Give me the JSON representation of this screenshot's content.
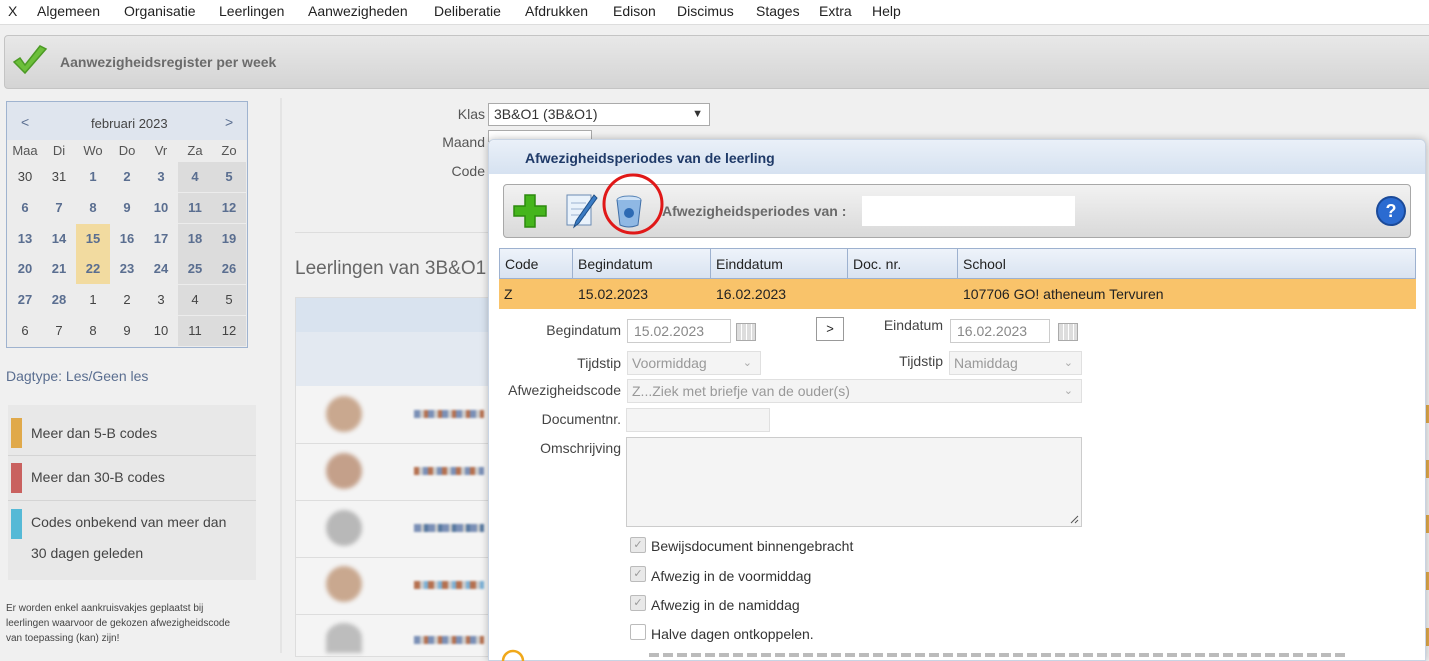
{
  "menu": [
    "X",
    "Algemeen",
    "Organisatie",
    "Leerlingen",
    "Aanwezigheden",
    "Deliberatie",
    "Afdrukken",
    "Edison",
    "Discimus",
    "Stages",
    "Extra",
    "Help"
  ],
  "page_title": "Aanwezigheidsregister per week",
  "calendar": {
    "prev": "<",
    "next": ">",
    "month": "februari 2023",
    "weekdays": [
      "Maa",
      "Di",
      "Wo",
      "Do",
      "Vr",
      "Za",
      "Zo"
    ],
    "rows": [
      [
        "30",
        "31",
        "1",
        "2",
        "3",
        "4",
        "5"
      ],
      [
        "6",
        "7",
        "8",
        "9",
        "10",
        "11",
        "12"
      ],
      [
        "13",
        "14",
        "15",
        "16",
        "17",
        "18",
        "19"
      ],
      [
        "20",
        "21",
        "22",
        "23",
        "24",
        "25",
        "26"
      ],
      [
        "27",
        "28",
        "1",
        "2",
        "3",
        "4",
        "5"
      ],
      [
        "6",
        "7",
        "8",
        "9",
        "10",
        "11",
        "12"
      ]
    ]
  },
  "dagtype": "Dagtype: Les/Geen les",
  "legend": [
    {
      "label": "Meer dan 5-B codes",
      "color": "#e0a94a"
    },
    {
      "label": "Meer dan 30-B codes",
      "color": "#c9615f"
    },
    {
      "label": "Codes onbekend van meer dan",
      "label2": "30 dagen geleden",
      "color": "#55b9d6"
    }
  ],
  "footnote": [
    "Er worden enkel aankruisvakjes geplaatst bij",
    "leerlingen waarvoor de gekozen afwezigheidscode",
    "van toepassing (kan) zijn!"
  ],
  "filters": {
    "klas_label": "Klas",
    "klas_value": "3B&O1 (3B&O1)",
    "maand_label": "Maand",
    "code_label": "Code"
  },
  "students_heading": "Leerlingen van 3B&O1",
  "dialog": {
    "title": "Afwezigheidsperiodes van de leerling",
    "toolbar_label": "Afwezigheidsperiodes van :",
    "columns": [
      "Code",
      "Begindatum",
      "Einddatum",
      "Doc. nr.",
      "School"
    ],
    "row": {
      "code": "Z",
      "begin": "15.02.2023",
      "eind": "16.02.2023",
      "doc": "",
      "school": "107706 GO! atheneum Tervuren"
    },
    "begindatum_label": "Begindatum",
    "begindatum_value": "15.02.2023",
    "copy_button": ">",
    "einddatum_label": "Eindatum",
    "einddatum_value": "16.02.2023",
    "tijdstip_label": "Tijdstip",
    "tijdstip1_value": "Voormiddag",
    "tijdstip2_label": "Tijdstip",
    "tijdstip2_value": "Namiddag",
    "afwcode_label": "Afwezigheidscode",
    "afwcode_value": "Z...Ziek met briefje van de ouder(s)",
    "docnr_label": "Documentnr.",
    "omschrijving_label": "Omschrijving",
    "checks": [
      {
        "label": "Bewijsdocument binnengebracht",
        "checked": true
      },
      {
        "label": "Afwezig in de voormiddag",
        "checked": true
      },
      {
        "label": "Afwezig in de namiddag",
        "checked": true
      },
      {
        "label": "Halve dagen ontkoppelen.",
        "checked": false
      }
    ]
  }
}
